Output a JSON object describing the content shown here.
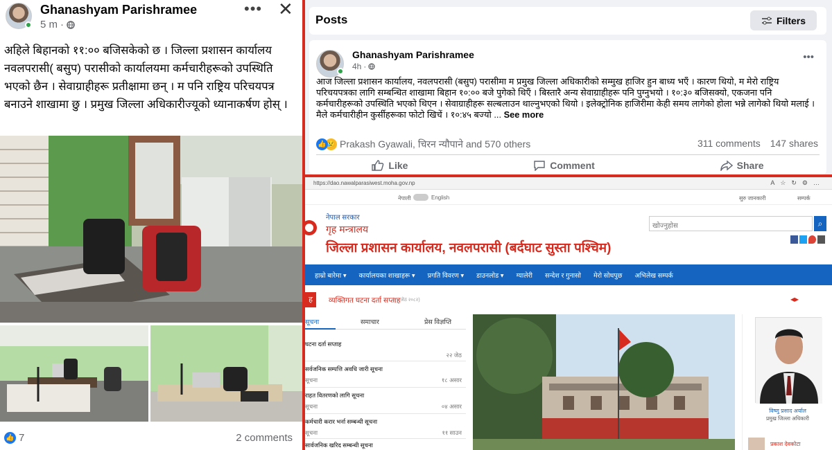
{
  "left_post": {
    "author": "Ghanashyam Parishramee",
    "time": "5 m",
    "separator": "·",
    "body": "अहिले बिहानको ११:०० बजिसकेको छ । जिल्ला प्रशासन कार्यालय नवलपरासी( बसुप) परासीको कार्यालयमा कर्मचारीहरूको उपस्थिति भएको छैन । सेवाग्राहीहरू प्रतीक्षामा छन् । म पनि राष्ट्रिय परिचयपत्र बनाउने शाखामा छु । प्रमुख जिल्ला अधिकारीज्यूको ध्यानाकर्षण होस् ।",
    "reaction_count": "7",
    "comments": "2 comments"
  },
  "right_post": {
    "section_title": "Posts",
    "filters_label": "Filters",
    "author": "Ghanashyam Parishramee",
    "time": "4h",
    "separator": "·",
    "body": "आज जिल्ला प्रशासन कार्यालय, नवलपरासी (बसुप) परासीमा म प्रमुख जिल्ला अधिकारीको सम्मुख हाजिर हुन बाध्य भएँ । कारण थियो, म मेरो राष्ट्रिय परिचयपत्रका लागि सम्बन्धित शाखामा बिहान १०:०० बजे पुगेको थिएँ । बिस्तारै अन्य सेवाग्राहीहरू पनि पुग्नुभयो । १०:३० बजिसक्यो, एकजना पनि कर्मचारीहरूको उपस्थिति भएको थिएन । सेवाग्राहीहरू सल्बलाउन थाल्नुभएको थियो । इलेक्ट्रोनिक हाजिरीमा केही समय लागेको होला भन्ने लागेको थियो मलाई । मैले कर्मचारीहीन कुर्सीहरूका फोटो खिचें । १०:४५ बज्यो ...",
    "see_more": "See more",
    "reactors": "Prakash Gyawali, चिरन न्यौपाने and 570 others",
    "comments": "311 comments",
    "shares": "147 shares",
    "like": "Like",
    "comment": "Comment",
    "share": "Share"
  },
  "website": {
    "url": "https://dao.nawalparasiwest.moha.gov.np",
    "lang_nep": "नेपाली",
    "lang_eng": "English",
    "top_right_info": "सुरु जानकारी",
    "contact": "सम्पर्क",
    "govt": "नेपाल सरकार",
    "ministry": "गृह मन्त्रालय",
    "office": "जिल्ला प्रशासन कार्यालय, नवलपरासी (बर्दघाट सुस्ता पश्चिम)",
    "search_placeholder": "खोज्नुहोस",
    "nav": [
      "हाम्रो बारेमा ▾",
      "कार्यालयका शाखाहरू ▾",
      "प्रगति विवरण ▾",
      "डाउनलोड ▾",
      "ग्यालेरी",
      "सन्देश र गुनासो",
      "मेरो सोधपुछ",
      "अभिलेख सम्पर्क"
    ],
    "ticker": "व्यक्तिगत घटना दर्ता सप्ताह",
    "ticker_date": "(१५ जेठ २०८२)",
    "tabs": [
      "सूचना",
      "समाचार",
      "प्रेस विज्ञप्ति"
    ],
    "notices": [
      {
        "title": "घटना दर्ता सप्ताह",
        "label": "",
        "date": "२२ जेठ"
      },
      {
        "title": "सर्वजनिक सम्पत्ति अवधि जारी सूचना",
        "label": "सूचना",
        "date": "१८ असार"
      },
      {
        "title": "राहत वितरणको लागि सूचना",
        "label": "सूचना",
        "date": "०४ असार"
      },
      {
        "title": "कर्मचारी करार भर्ना सम्बन्धी सूचना",
        "label": "सूचना",
        "date": "११ साउन"
      },
      {
        "title": "सार्वजनिक खरिद सम्बन्धी सूचना",
        "label": "",
        "date": ""
      }
    ],
    "cdo_name": "विष्णु प्रसाद अर्याल",
    "cdo_title": "प्रमुख जिल्ला अधिकारी",
    "info_officer": "प्रकाश देवकोटा"
  }
}
